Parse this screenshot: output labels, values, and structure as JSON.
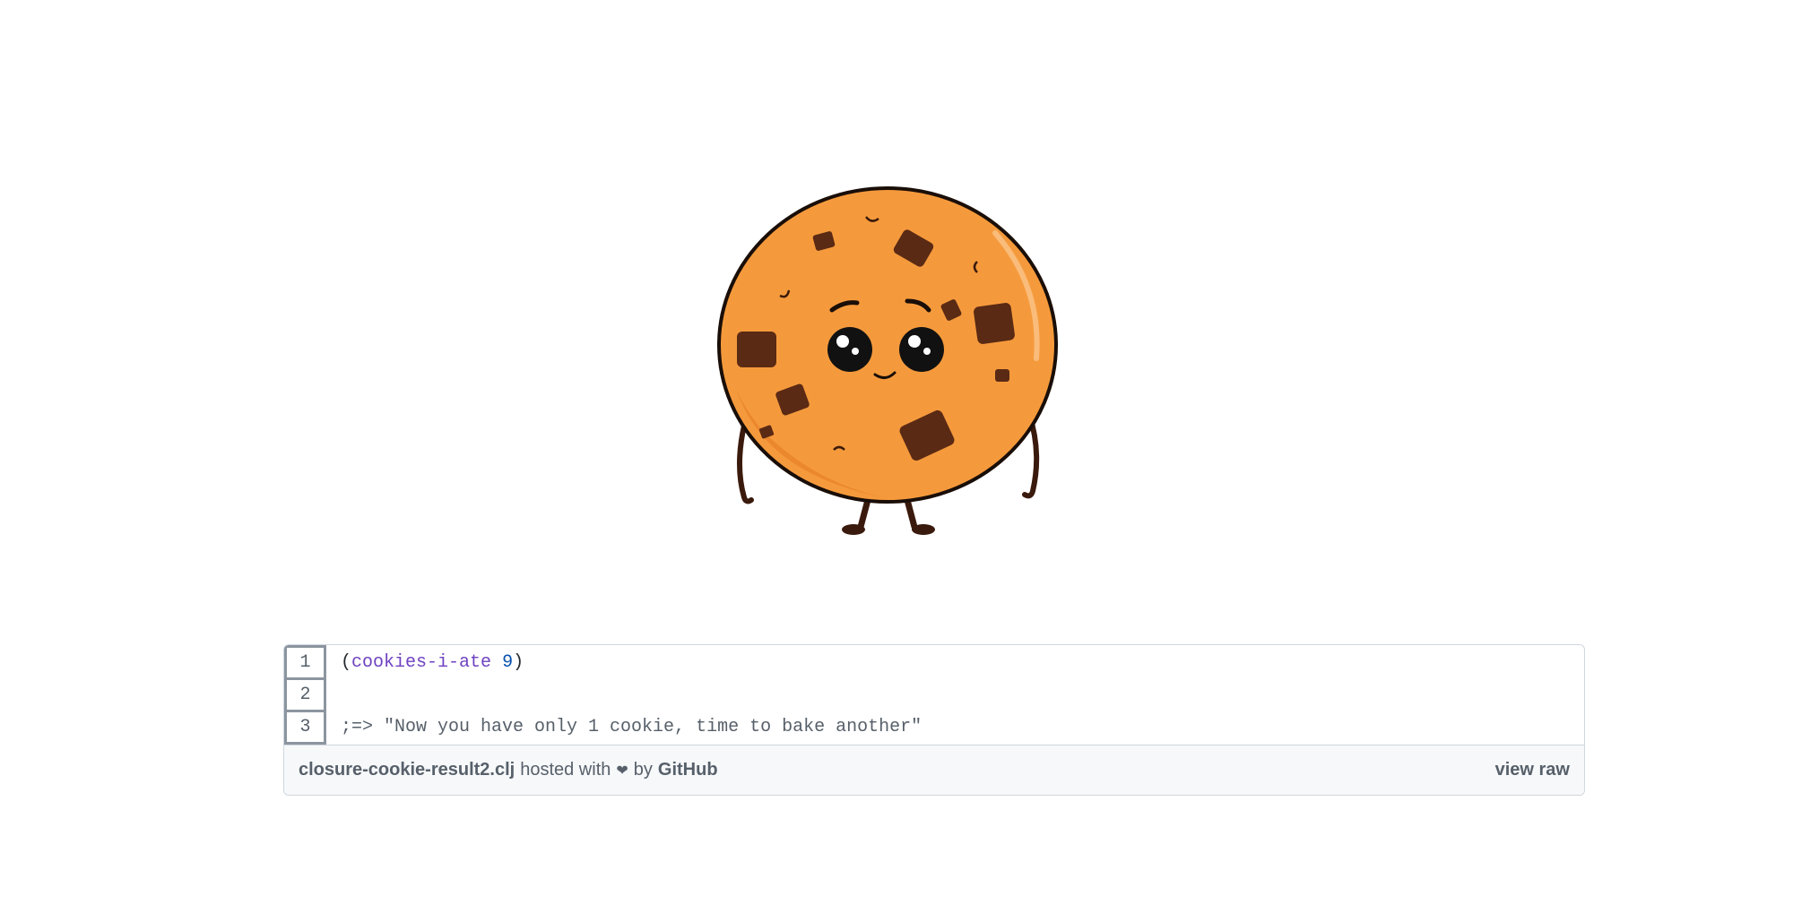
{
  "illustration": {
    "icon": "cookie-character-icon",
    "colors": {
      "dough": "#f59a3c",
      "dough_shadow": "#e8832a",
      "chips": "#5a2a14",
      "outline": "#1a0e08"
    }
  },
  "gist": {
    "lines": [
      {
        "number": "1",
        "open": "(",
        "fn": "cookies-i-ate",
        "space": " ",
        "num": "9",
        "close": ")"
      },
      {
        "number": "2",
        "text": ""
      },
      {
        "number": "3",
        "comment": ";=> \"Now you have only 1 cookie, time to bake another\""
      }
    ],
    "meta": {
      "filename": "closure-cookie-result2.clj",
      "hosted_with": "hosted with",
      "heart": "❤",
      "by": "by",
      "host": "GitHub",
      "view_raw": "view raw"
    }
  }
}
